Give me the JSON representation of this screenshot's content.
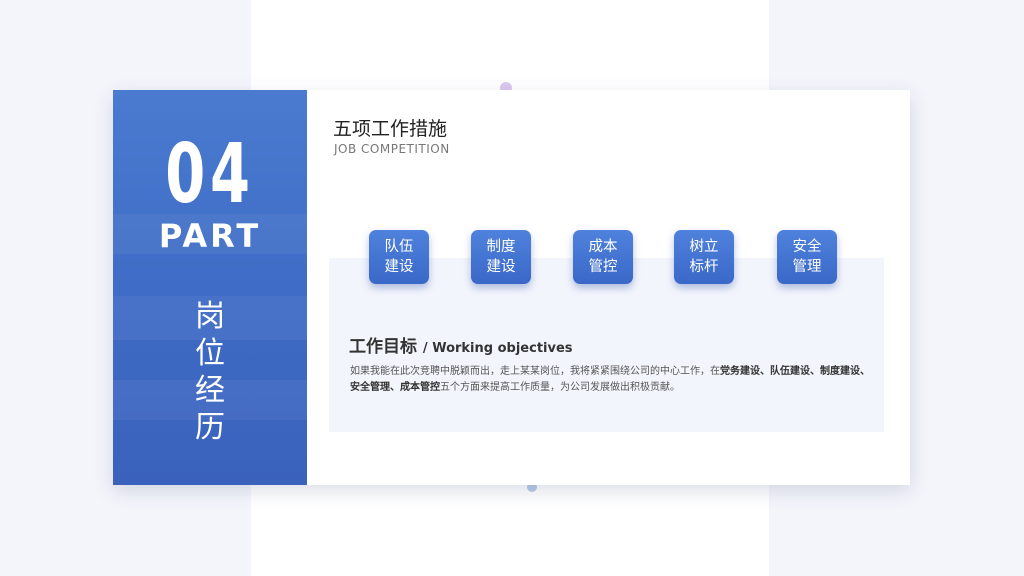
{
  "colors": {
    "accent": "#3f6cc6",
    "background": "#f4f5fb"
  },
  "part": {
    "number": "04",
    "word": "PART",
    "title_chars": [
      "岗",
      "位",
      "经",
      "历"
    ]
  },
  "header": {
    "title": "五项工作措施",
    "subtitle": "JOB COMPETITION"
  },
  "measures": [
    {
      "line1": "队伍",
      "line2": "建设"
    },
    {
      "line1": "制度",
      "line2": "建设"
    },
    {
      "line1": "成本",
      "line2": "管控"
    },
    {
      "line1": "树立",
      "line2": "标杆"
    },
    {
      "line1": "安全",
      "line2": "管理"
    }
  ],
  "objective": {
    "title_zh": "工作目标",
    "title_en": "/ Working objectives",
    "text_a": "如果我能在此次竞聘中脱颖而出，走上某某岗位，我将紧紧围绕公司的中心工作，在",
    "bold_a": "党务建设、队伍建设、制度建设、安全管理、成本管控",
    "text_b": "五个方面来提高工作质量，为公司发展做出积极贡献。"
  }
}
